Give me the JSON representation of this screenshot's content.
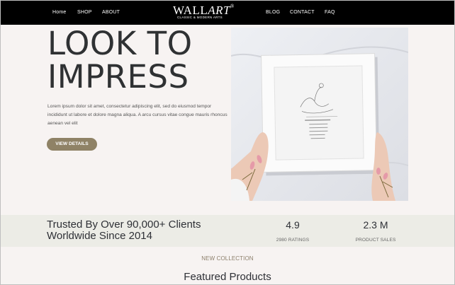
{
  "nav": {
    "left": [
      "Home",
      "SHOP",
      "ABOUT"
    ],
    "right": [
      "BLOG",
      "CONTACT",
      "FAQ"
    ]
  },
  "logo": {
    "wall": "WALL",
    "art": "ART",
    "mark": "®",
    "tagline": "CLASSIC & MODERN ARTS"
  },
  "hero": {
    "title_line1": "LOOK TO",
    "title_line2": "IMPRESS",
    "description": "Lorem ipsum dolor sit amet, consectetur adipiscing elit, sed do eiusmod tempor incididunt ut labore et dolore magna aliqua. A arcu cursus vitae congue mauris rhoncus aenean vel elit",
    "button_label": "VIEW DETAILS",
    "image_icon": "framed-art-photo"
  },
  "stats": {
    "trust_line1": "Trusted By Over 90,000+ Clients",
    "trust_line2": "Worldwide Since 2014",
    "rating_value": "4.9",
    "rating_label": "2980 RATINGS",
    "sales_value": "2.3 M",
    "sales_label": "PRODUCT SALES"
  },
  "featured": {
    "kicker": "NEW COLLECTION",
    "title": "Featured Products"
  },
  "colors": {
    "header_bg": "#000000",
    "page_bg": "#f7f3f2",
    "accent": "#8f8266",
    "stats_bg": "#ecece6"
  }
}
